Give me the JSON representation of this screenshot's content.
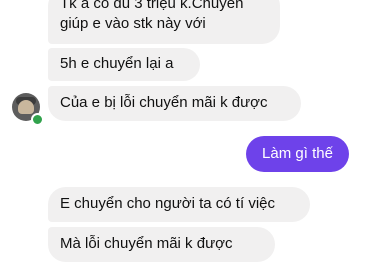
{
  "messages": [
    {
      "sender": "contact",
      "lines": [
        "Tk a có đủ 3 triệu k.Chuyển",
        "giúp e vào stk này với"
      ]
    },
    {
      "sender": "contact",
      "text": "5h e chuyển lại a"
    },
    {
      "sender": "contact",
      "text": "Của e bị lỗi chuyển mãi k được"
    },
    {
      "sender": "me",
      "text": "Làm gì thế"
    },
    {
      "sender": "contact",
      "text": "E chuyển cho người ta có tí việc"
    },
    {
      "sender": "contact",
      "text": "Mà lỗi chuyển mãi k được"
    }
  ],
  "contact": {
    "avatar_icon": "avatar-photo-icon",
    "status": "online"
  },
  "colors": {
    "incoming_bubble": "#f1f0f0",
    "outgoing_bubble": "#6e42ea",
    "online": "#31a24c"
  }
}
